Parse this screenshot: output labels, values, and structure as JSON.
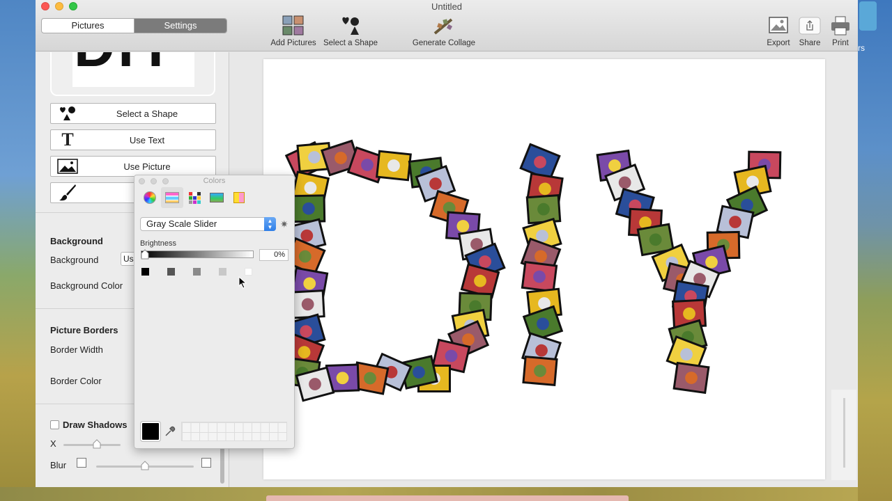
{
  "window": {
    "title": "Untitled"
  },
  "toolbar": {
    "tabs": [
      "Pictures",
      "Settings"
    ],
    "selected_tab": "Settings",
    "add_pictures": "Add Pictures",
    "select_shape": "Select a Shape",
    "generate_collage": "Generate Collage",
    "export": "Export",
    "share": "Share",
    "print": "Print"
  },
  "left_panel": {
    "preview_text": "DIY",
    "select_shape": "Select a Shape",
    "use_text": "Use Text",
    "use_picture": "Use Picture",
    "draw": "Draw",
    "background_title": "Background",
    "background_label": "Background",
    "background_value": "Us",
    "background_color_label": "Background Color",
    "picture_borders_title": "Picture Borders",
    "border_width_label": "Border Width",
    "border_color_label": "Border Color",
    "draw_shadows": "Draw Shadows",
    "x_label": "X",
    "blur_label": "Blur"
  },
  "colors_panel": {
    "title": "Colors",
    "mode": "Gray Scale Slider",
    "brightness_label": "Brightness",
    "brightness_value": "0%",
    "brightness": 0,
    "swatches": [
      "#000000",
      "#555555",
      "#8a8a8a",
      "#c8c8c8",
      "#ffffff"
    ],
    "current_color": "#000000"
  },
  "collage": {
    "letters": [
      "D",
      "I",
      "Y"
    ],
    "tile_palette": [
      "#c8485e",
      "#e6b820",
      "#4a7a2c",
      "#b8c0d8",
      "#d66a2a",
      "#7a4aa8",
      "#e8e8e8",
      "#2a4e9a",
      "#b83838",
      "#6a8a3a",
      "#f0d040",
      "#9a5a6a"
    ]
  },
  "desktop": {
    "partial_text": "rs"
  }
}
